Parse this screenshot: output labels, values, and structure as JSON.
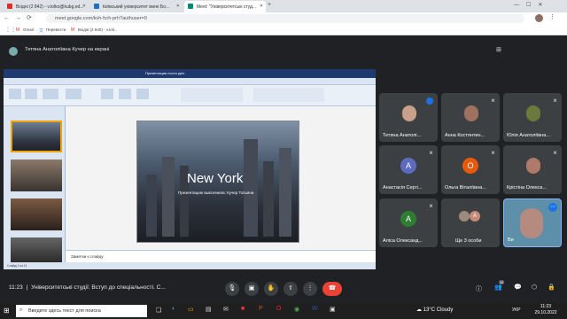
{
  "tabs": [
    {
      "label": "Вхідні (2 842) - v.tolko@kubg.ed..."
    },
    {
      "label": "Київський університет імені Бо..."
    },
    {
      "label": "Meet: \"Університетські студ..."
    }
  ],
  "url": "meet.google.com/kvh-fcrh-prh?authuser=0",
  "bookmarks": [
    "Gmail",
    "Перевести",
    "Вхідні (2 840) - v.toli..."
  ],
  "presenter_label": "Тетяна Анатоліївна Кучер на екрані",
  "participants": [
    {
      "name": "Тетяна Анатолі...",
      "type": "photo"
    },
    {
      "name": "Анна Костянтин...",
      "type": "photo"
    },
    {
      "name": "Юлія Анатоліївна...",
      "type": "photo"
    },
    {
      "name": "Анастасія Сергі...",
      "initial": "А",
      "color": "#5c6bc0"
    },
    {
      "name": "Ольга Віталіївна...",
      "initial": "О",
      "color": "#e8590c"
    },
    {
      "name": "Крістіна Олекса...",
      "type": "photo"
    },
    {
      "name": "Аліса Олександ...",
      "initial": "А",
      "color": "#2e7d32"
    },
    {
      "name": "Ще 3 особи",
      "type": "group"
    },
    {
      "name": "Ви",
      "type": "self"
    }
  ],
  "ppt": {
    "title": "Презентация носта.pptx",
    "slide_title": "New York",
    "slide_subtitle": "Презентацию выполнила: Кучер Татьяна",
    "notes": "Заметки к слайду",
    "status": "Слайд 1 из 11"
  },
  "meeting": {
    "time": "11:23",
    "title": "Університетські студії: Вступ до спеціальності. С...",
    "participants_count": "12"
  },
  "taskbar": {
    "search_placeholder": "Введите здесь текст для поиска",
    "weather": "13°C Cloudy",
    "lang": "УКР",
    "clock_time": "11:23",
    "clock_date": "29.10.2022"
  }
}
